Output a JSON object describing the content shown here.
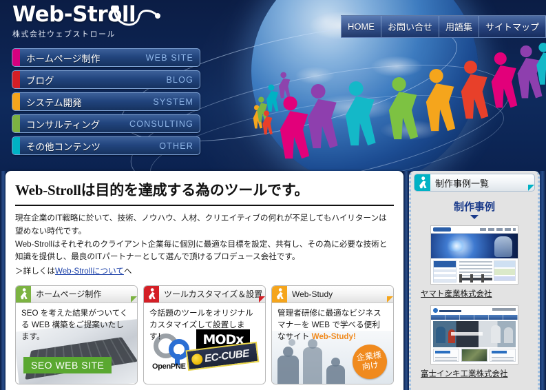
{
  "site": {
    "logo_main": "Web-Stroll",
    "logo_sub": "株式会社ウェブストロール"
  },
  "topnav": {
    "items": [
      {
        "label": "HOME",
        "name": "nav-home"
      },
      {
        "label": "お問い合せ",
        "name": "nav-contact"
      },
      {
        "label": "用語集",
        "name": "nav-glossary"
      },
      {
        "label": "サイトマップ",
        "name": "nav-sitemap"
      }
    ]
  },
  "leftmenu": {
    "items": [
      {
        "jp": "ホームページ制作",
        "en": "WEB SITE",
        "color": "#d6007f"
      },
      {
        "jp": "ブログ",
        "en": "BLOG",
        "color": "#d41f26"
      },
      {
        "jp": "システム開発",
        "en": "SYSTEM",
        "color": "#f5a51c"
      },
      {
        "jp": "コンサルティング",
        "en": "CONSULTING",
        "color": "#7cb342"
      },
      {
        "jp": "その他コンテンツ",
        "en": "OTHER",
        "color": "#00b2c4"
      }
    ]
  },
  "main": {
    "headline": "Web-Strollは目的を達成する為のツールです。",
    "paragraphs": [
      "現在企業のIT戦略に於いて、技術、ノウハウ、人材、クリエイティブの何れが不足してもハイリターンは望めない時代です。",
      "Web-Strollはそれぞれのクライアント企業毎に個別に最適な目標を設定、共有し、その為に必要な技術と知識を提供し、最良のITパートナーとして選んで頂けるプロデュース会社です。"
    ],
    "more_prefix": "＞詳しくは",
    "more_link": "Web-Strollについて",
    "more_suffix": "へ"
  },
  "cards": [
    {
      "name": "card-homepage",
      "title": "ホームページ制作",
      "accent": "#7cb342",
      "icon": "pedestrian-icon",
      "text": "SEO を考えた結果がついてくる WEB 構築をご提案いたします。",
      "button": "SEO WEB SITE"
    },
    {
      "name": "card-tool-customize",
      "title": "ツールカスタマイズ＆設置",
      "accent": "#d41f26",
      "icon": "pedestrian-icon",
      "text": "今話題のツールをオリジナルカスタマイズして設置します！",
      "logos": [
        "OpenPNE",
        "MODx",
        "EC-CUBE"
      ]
    },
    {
      "name": "card-web-study",
      "title": "Web-Study",
      "accent": "#f5a51c",
      "icon": "pedestrian-icon",
      "text_lead": "管理者研修に最適なビジネスマナーを WEB で学べる便利なサイト ",
      "text_highlight": "Web-Study!",
      "badge_line1": "企業様",
      "badge_line2": "向け"
    }
  ],
  "sidebar": {
    "header": "制作事例一覧",
    "header_icon": "pedestrian-icon",
    "accent": "#00b2c4",
    "section_title": "制作事例",
    "cases": [
      {
        "caption": "ヤマト産業株式会社",
        "name": "case-yamato"
      },
      {
        "caption": "富士インキ工業株式会社",
        "name": "case-fuji-ink"
      }
    ]
  }
}
